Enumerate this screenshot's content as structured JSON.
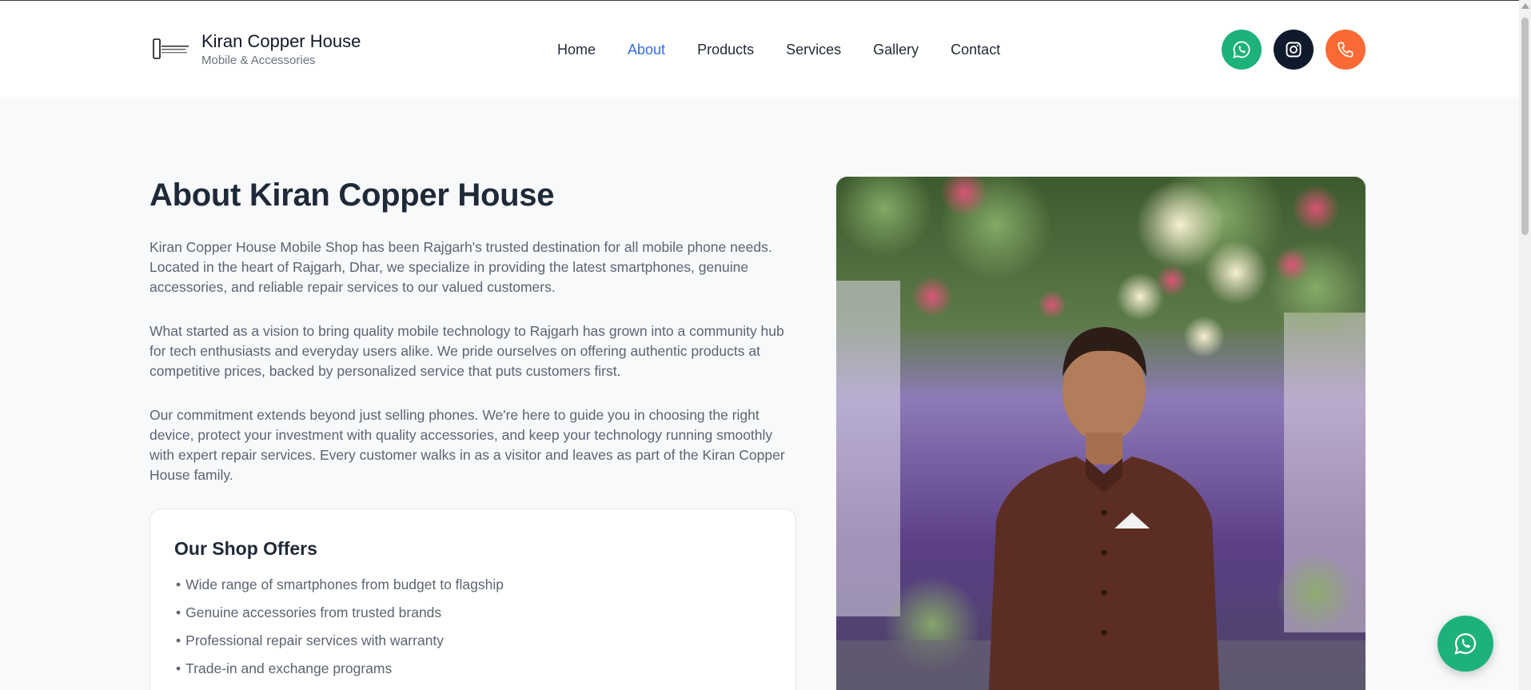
{
  "header": {
    "brand_name": "Kiran Copper House",
    "brand_sub": "Mobile & Accessories",
    "nav": [
      {
        "label": "Home",
        "active": false
      },
      {
        "label": "About",
        "active": true
      },
      {
        "label": "Products",
        "active": false
      },
      {
        "label": "Services",
        "active": false
      },
      {
        "label": "Gallery",
        "active": false
      },
      {
        "label": "Contact",
        "active": false
      }
    ],
    "social": [
      {
        "icon": "whatsapp-icon",
        "color": "#1db27a"
      },
      {
        "icon": "instagram-icon",
        "color": "#0f1b2d"
      },
      {
        "icon": "phone-icon",
        "color": "#fb6a34"
      }
    ]
  },
  "about": {
    "title": "About Kiran Copper House",
    "paragraphs": [
      "Kiran Copper House Mobile Shop has been Rajgarh's trusted destination for all mobile phone needs. Located in the heart of Rajgarh, Dhar, we specialize in providing the latest smartphones, genuine accessories, and reliable repair services to our valued customers.",
      "What started as a vision to bring quality mobile technology to Rajgarh has grown into a community hub for tech enthusiasts and everyday users alike. We pride ourselves on offering authentic products at competitive prices, backed by personalized service that puts customers first.",
      "Our commitment extends beyond just selling phones. We're here to guide you in choosing the right device, protect your investment with quality accessories, and keep your technology running smoothly with expert repair services. Every customer walks in as a visitor and leaves as part of the Kiran Copper House family."
    ]
  },
  "offers": {
    "title": "Our Shop Offers",
    "bullet": "•",
    "items": [
      "Wide range of smartphones from budget to flagship",
      "Genuine accessories from trusted brands",
      "Professional repair services with warranty",
      "Trade-in and exchange programs"
    ]
  },
  "colors": {
    "accent": "#2f6fdf",
    "whatsapp": "#1db27a",
    "instagram": "#0f1b2d",
    "phone": "#fb6a34"
  }
}
